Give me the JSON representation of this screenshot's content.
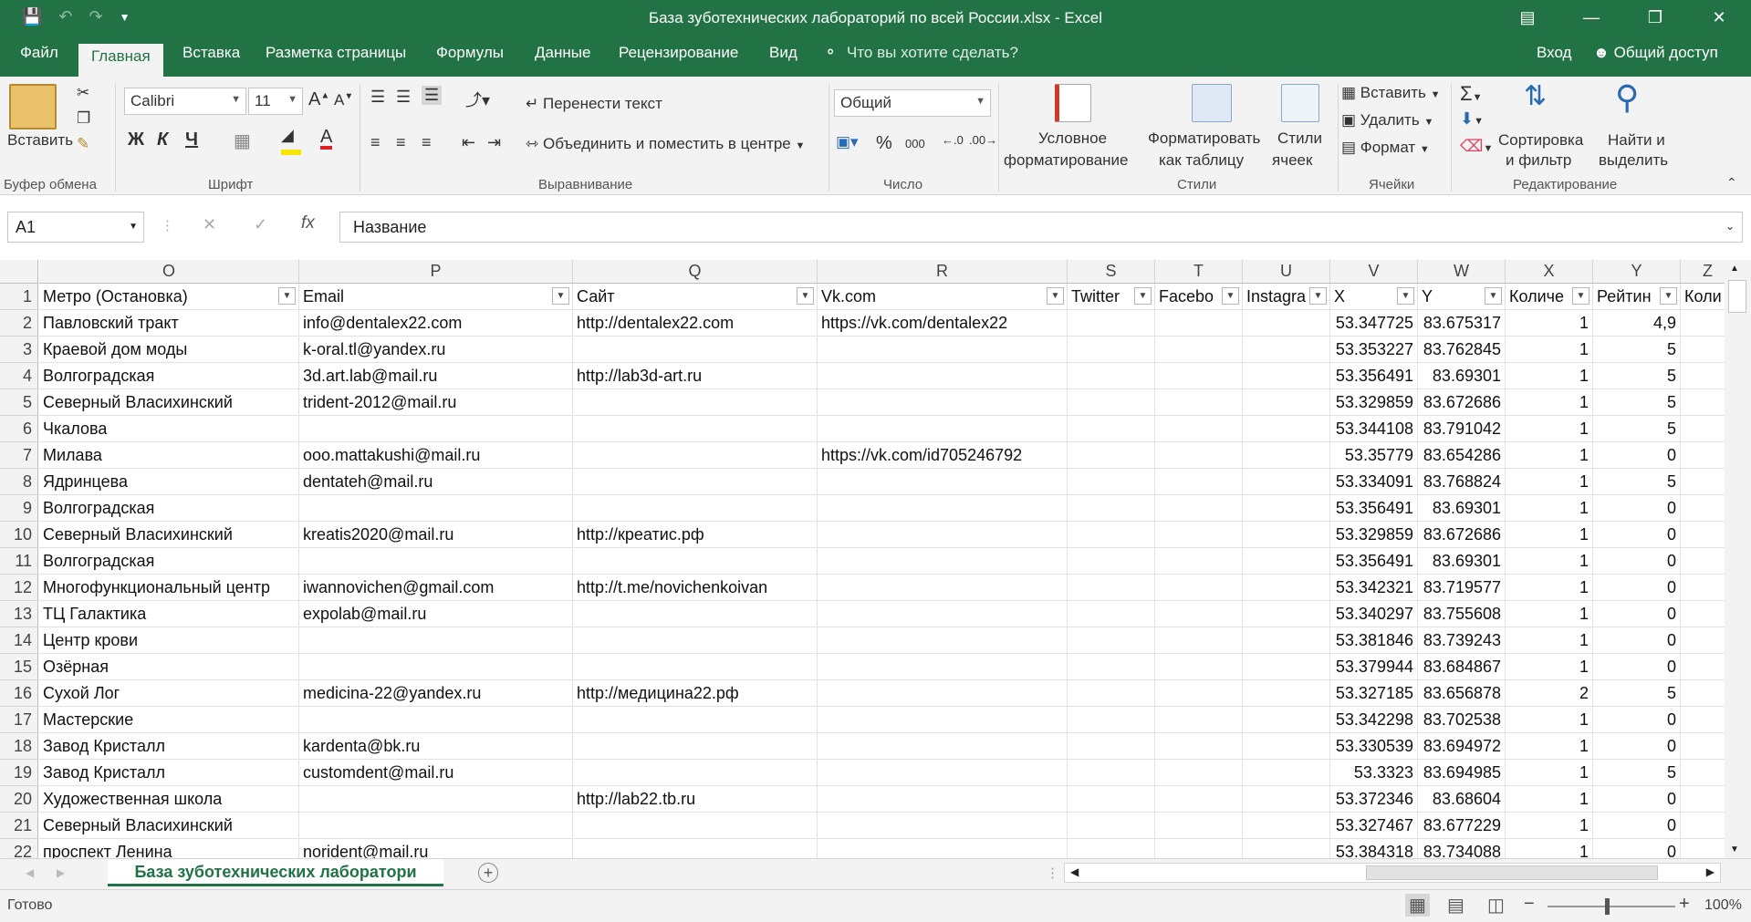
{
  "window": {
    "title": "База зуботехнических лабораторий по всей России.xlsx - Excel"
  },
  "menu": {
    "tabs": [
      "Файл",
      "Главная",
      "Вставка",
      "Разметка страницы",
      "Формулы",
      "Данные",
      "Рецензирование",
      "Вид"
    ],
    "tell_me": "Что вы хотите сделать?",
    "signin": "Вход",
    "share": "Общий доступ"
  },
  "ribbon": {
    "clipboard": {
      "paste": "Вставить",
      "label": "Буфер обмена"
    },
    "font": {
      "name": "Calibri",
      "size": "11",
      "bold": "Ж",
      "italic": "К",
      "underline": "Ч",
      "label": "Шрифт"
    },
    "alignment": {
      "wrap": "Перенести текст",
      "merge": "Объединить и поместить в центре",
      "label": "Выравнивание"
    },
    "number": {
      "format": "Общий",
      "percent": "%",
      "thousands": "000",
      "label": "Число"
    },
    "styles": {
      "conditional1": "Условное",
      "conditional2": "форматирование",
      "table1": "Форматировать",
      "table2": "как таблицу",
      "cell1": "Стили",
      "cell2": "ячеек",
      "label": "Стили"
    },
    "cells": {
      "insert": "Вставить",
      "delete": "Удалить",
      "format": "Формат",
      "label": "Ячейки"
    },
    "editing": {
      "sort1": "Сортировка",
      "sort2": "и фильтр",
      "find1": "Найти и",
      "find2": "выделить",
      "label": "Редактирование"
    }
  },
  "formula_bar": {
    "name_box": "A1",
    "formula": "Название"
  },
  "sheet": {
    "columns": [
      {
        "letter": "O",
        "header": "Метро (Остановка)"
      },
      {
        "letter": "P",
        "header": "Email"
      },
      {
        "letter": "Q",
        "header": "Сайт"
      },
      {
        "letter": "R",
        "header": "Vk.com"
      },
      {
        "letter": "S",
        "header": "Twitter"
      },
      {
        "letter": "T",
        "header": "Facebo"
      },
      {
        "letter": "U",
        "header": "Instagra"
      },
      {
        "letter": "V",
        "header": "X"
      },
      {
        "letter": "W",
        "header": "Y"
      },
      {
        "letter": "X",
        "header": "Количе"
      },
      {
        "letter": "Y",
        "header": "Рейтин"
      },
      {
        "letter": "Z",
        "header": "Коли"
      }
    ],
    "rows": [
      {
        "n": "2",
        "c": [
          "Павловский тракт",
          "info@dentalex22.com",
          "http://dentalex22.com",
          "https://vk.com/dentalex22",
          "",
          "",
          "",
          "53.347725",
          "83.675317",
          "1",
          "4,9",
          ""
        ]
      },
      {
        "n": "3",
        "c": [
          "Краевой дом моды",
          "k-oral.tl@yandex.ru",
          "",
          "",
          "",
          "",
          "",
          "53.353227",
          "83.762845",
          "1",
          "5",
          ""
        ]
      },
      {
        "n": "4",
        "c": [
          "Волгоградская",
          "3d.art.lab@mail.ru",
          "http://lab3d-art.ru",
          "",
          "",
          "",
          "",
          "53.356491",
          "83.69301",
          "1",
          "5",
          ""
        ]
      },
      {
        "n": "5",
        "c": [
          "Северный Власихинский",
          "trident-2012@mail.ru",
          "",
          "",
          "",
          "",
          "",
          "53.329859",
          "83.672686",
          "1",
          "5",
          ""
        ]
      },
      {
        "n": "6",
        "c": [
          "Чкалова",
          "",
          "",
          "",
          "",
          "",
          "",
          "53.344108",
          "83.791042",
          "1",
          "5",
          ""
        ]
      },
      {
        "n": "7",
        "c": [
          "Милава",
          "ooo.mattakushi@mail.ru",
          "",
          "https://vk.com/id705246792",
          "",
          "",
          "",
          "53.35779",
          "83.654286",
          "1",
          "0",
          ""
        ]
      },
      {
        "n": "8",
        "c": [
          "Ядринцева",
          "dentateh@mail.ru",
          "",
          "",
          "",
          "",
          "",
          "53.334091",
          "83.768824",
          "1",
          "5",
          ""
        ]
      },
      {
        "n": "9",
        "c": [
          "Волгоградская",
          "",
          "",
          "",
          "",
          "",
          "",
          "53.356491",
          "83.69301",
          "1",
          "0",
          ""
        ]
      },
      {
        "n": "10",
        "c": [
          "Северный Власихинский",
          "kreatis2020@mail.ru",
          "http://креатис.рф",
          "",
          "",
          "",
          "",
          "53.329859",
          "83.672686",
          "1",
          "0",
          ""
        ]
      },
      {
        "n": "11",
        "c": [
          "Волгоградская",
          "",
          "",
          "",
          "",
          "",
          "",
          "53.356491",
          "83.69301",
          "1",
          "0",
          ""
        ]
      },
      {
        "n": "12",
        "c": [
          "Многофункциональный центр",
          "iwannovichen@gmail.com",
          "http://t.me/novichenkoivan",
          "",
          "",
          "",
          "",
          "53.342321",
          "83.719577",
          "1",
          "0",
          ""
        ]
      },
      {
        "n": "13",
        "c": [
          "ТЦ Галактика",
          "expolab@mail.ru",
          "",
          "",
          "",
          "",
          "",
          "53.340297",
          "83.755608",
          "1",
          "0",
          ""
        ]
      },
      {
        "n": "14",
        "c": [
          "Центр крови",
          "",
          "",
          "",
          "",
          "",
          "",
          "53.381846",
          "83.739243",
          "1",
          "0",
          ""
        ]
      },
      {
        "n": "15",
        "c": [
          "Озёрная",
          "",
          "",
          "",
          "",
          "",
          "",
          "53.379944",
          "83.684867",
          "1",
          "0",
          ""
        ]
      },
      {
        "n": "16",
        "c": [
          "Сухой Лог",
          "medicina-22@yandex.ru",
          "http://медицина22.рф",
          "",
          "",
          "",
          "",
          "53.327185",
          "83.656878",
          "2",
          "5",
          ""
        ]
      },
      {
        "n": "17",
        "c": [
          "Мастерские",
          "",
          "",
          "",
          "",
          "",
          "",
          "53.342298",
          "83.702538",
          "1",
          "0",
          ""
        ]
      },
      {
        "n": "18",
        "c": [
          "Завод Кристалл",
          "kardenta@bk.ru",
          "",
          "",
          "",
          "",
          "",
          "53.330539",
          "83.694972",
          "1",
          "0",
          ""
        ]
      },
      {
        "n": "19",
        "c": [
          "Завод Кристалл",
          "customdent@mail.ru",
          "",
          "",
          "",
          "",
          "",
          "53.3323",
          "83.694985",
          "1",
          "5",
          ""
        ]
      },
      {
        "n": "20",
        "c": [
          "Художественная школа",
          "",
          "http://lab22.tb.ru",
          "",
          "",
          "",
          "",
          "53.372346",
          "83.68604",
          "1",
          "0",
          ""
        ]
      },
      {
        "n": "21",
        "c": [
          "Северный Власихинский",
          "",
          "",
          "",
          "",
          "",
          "",
          "53.327467",
          "83.677229",
          "1",
          "0",
          ""
        ]
      },
      {
        "n": "22",
        "c": [
          "проспект Ленина",
          "norident@mail.ru",
          "",
          "",
          "",
          "",
          "",
          "53.384318",
          "83.734088",
          "1",
          "0",
          ""
        ]
      }
    ]
  },
  "sheet_tab": "База зуботехнических лаборатори",
  "status": {
    "ready": "Готово",
    "zoom": "100%"
  }
}
